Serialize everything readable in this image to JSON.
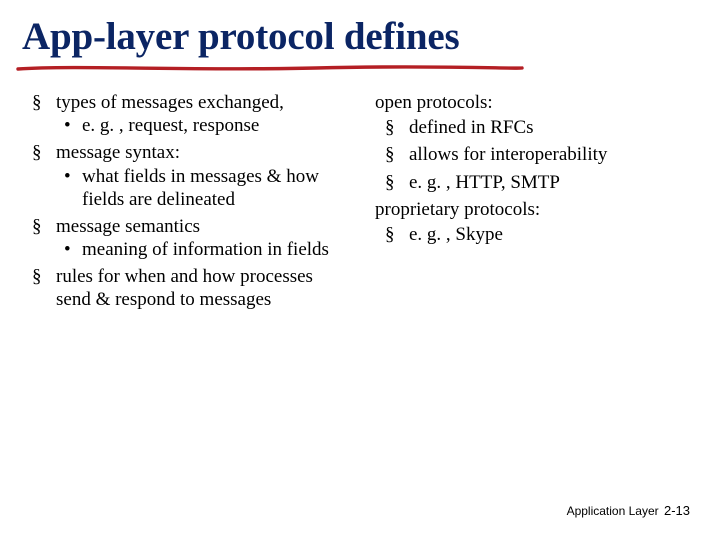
{
  "title": "App-layer protocol defines",
  "left": {
    "items": [
      {
        "text": "types of messages exchanged,",
        "sub": [
          "e. g. , request, response"
        ]
      },
      {
        "text": "message syntax:",
        "sub": [
          "what fields in messages & how fields are delineated"
        ]
      },
      {
        "text": "message semantics",
        "sub": [
          "meaning of information in fields"
        ]
      },
      {
        "text": "rules for when and how processes send & respond to messages",
        "sub": []
      }
    ]
  },
  "right": {
    "sections": [
      {
        "heading": "open protocols:",
        "items": [
          "defined in RFCs",
          "allows for interoperability",
          "e. g. , HTTP, SMTP"
        ]
      },
      {
        "heading": "proprietary protocols:",
        "items": [
          "e. g. , Skype"
        ]
      }
    ]
  },
  "footer": {
    "section": "Application Layer",
    "page": "2-13"
  }
}
